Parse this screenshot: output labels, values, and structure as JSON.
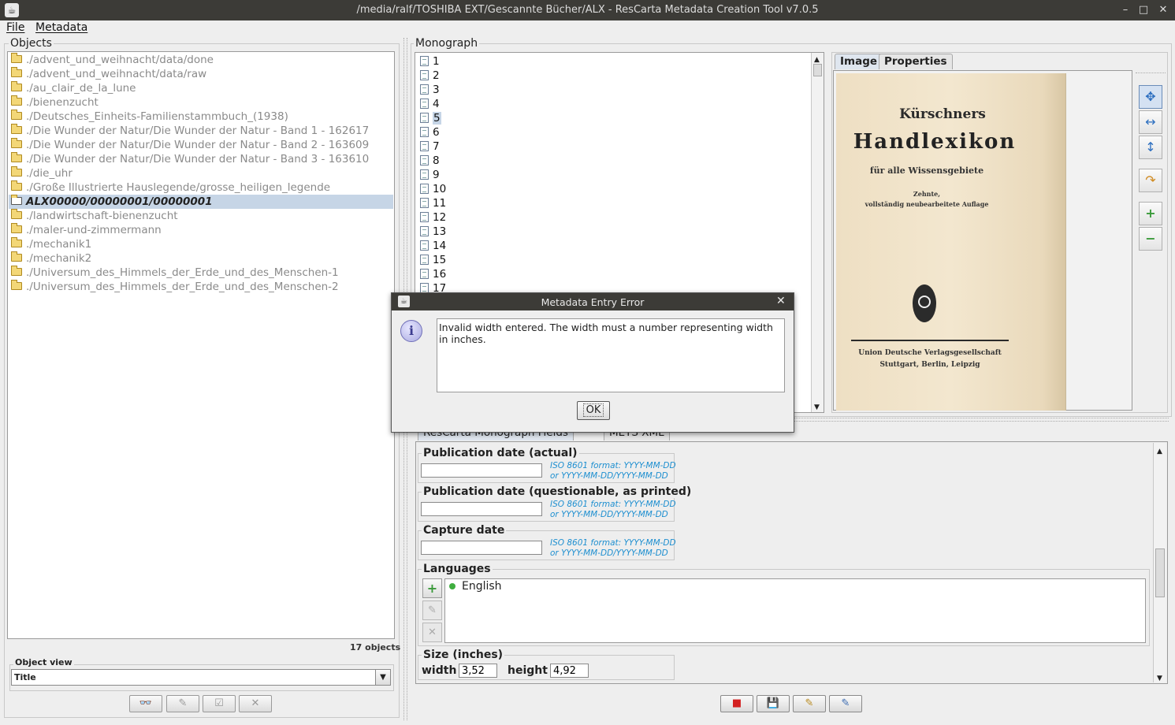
{
  "window": {
    "title": "/media/ralf/TOSHIBA EXT/Gescannte Bücher/ALX - ResCarta Metadata Creation Tool v7.0.5",
    "minimize": "–",
    "maximize": "□",
    "close": "✕"
  },
  "menu": {
    "file": "File",
    "metadata": "Metadata"
  },
  "objects": {
    "title": "Objects",
    "items": [
      {
        "label": "./advent_und_weihnacht/data/done"
      },
      {
        "label": "./advent_und_weihnacht/data/raw"
      },
      {
        "label": "./au_clair_de_la_lune"
      },
      {
        "label": "./bienenzucht"
      },
      {
        "label": "./Deutsches_Einheits-Familienstammbuch_(1938)"
      },
      {
        "label": "./Die Wunder der Natur/Die Wunder der Natur - Band 1 - 162617"
      },
      {
        "label": "./Die Wunder der Natur/Die Wunder der Natur - Band 2 - 163609"
      },
      {
        "label": "./Die Wunder der Natur/Die Wunder der Natur - Band 3 - 163610"
      },
      {
        "label": "./die_uhr"
      },
      {
        "label": "./Große Illustrierte Hauslegende/grosse_heiligen_legende"
      },
      {
        "label": "ALX00000/00000001/00000001"
      },
      {
        "label": "./landwirtschaft-bienenzucht"
      },
      {
        "label": "./maler-und-zimmermann"
      },
      {
        "label": "./mechanik1"
      },
      {
        "label": "./mechanik2"
      },
      {
        "label": "./Universum_des_Himmels_der_Erde_und_des_Menschen-1"
      },
      {
        "label": "./Universum_des_Himmels_der_Erde_und_des_Menschen-2"
      }
    ],
    "count": "17 objects",
    "view_label": "Object view",
    "view_value": "Title"
  },
  "monograph": {
    "title": "Monograph",
    "pages": [
      "1",
      "2",
      "3",
      "4",
      "5",
      "6",
      "7",
      "8",
      "9",
      "10",
      "11",
      "12",
      "13",
      "14",
      "15",
      "16",
      "17"
    ],
    "selected_page": "5"
  },
  "viewer": {
    "tabs": [
      "Image",
      "Properties"
    ],
    "book": {
      "line1": "Kürschners",
      "line2": "Handlexikon",
      "line3": "für alle Wissensgebiete",
      "line4": "Zehnte,",
      "line5": "vollständig neubearbeitete Auflage",
      "line6": "Union Deutsche Verlagsgesellschaft",
      "line7": "Stuttgart, Berlin, Leipzig"
    }
  },
  "field_tabs": [
    "ResCarta Monograph Fields",
    "METS XML"
  ],
  "fields": {
    "pub_actual": {
      "label": "Publication date (actual)",
      "value": ""
    },
    "pub_questionable": {
      "label": "Publication date (questionable, as printed)",
      "value": ""
    },
    "capture": {
      "label": "Capture date",
      "value": ""
    },
    "date_hint_1": "ISO 8601 format: YYYY-MM-DD",
    "date_hint_2": "or YYYY-MM-DD/YYYY-MM-DD",
    "languages": {
      "label": "Languages",
      "items": [
        "English"
      ]
    },
    "size": {
      "label": "Size (inches)",
      "width_label": "width",
      "width": "3,52",
      "height_label": "height",
      "height": "4,92"
    }
  },
  "dialog": {
    "title": "Metadata Entry Error",
    "message": "Invalid width entered. The width must a number representing width in inches.",
    "ok": "OK"
  },
  "colors": {
    "titlebar": "#3c3b37",
    "selection": "#c6d5e6",
    "hint": "#1e8fd0",
    "accent": "#2d6fc0"
  }
}
